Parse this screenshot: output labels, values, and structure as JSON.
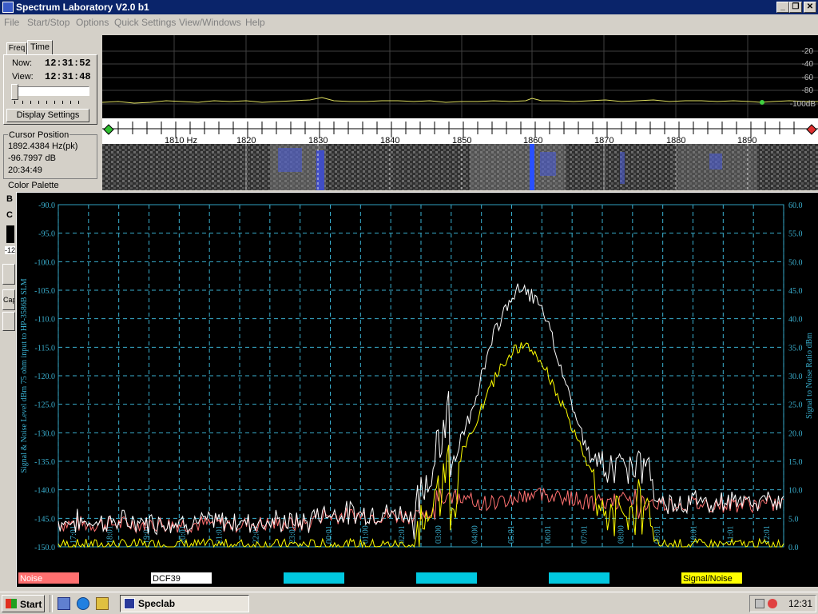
{
  "window": {
    "title": "Spectrum Laboratory V2.0 b1"
  },
  "menu": [
    "File",
    "Start/Stop",
    "Options",
    "Quick Settings",
    "View/Windows",
    "Help"
  ],
  "left_panel": {
    "tabs": [
      "Freq",
      "Time"
    ],
    "now_label": "Now:",
    "now_value": "12:31:52",
    "view_label": "View:",
    "view_value": "12:31:48",
    "display_settings": "Display Settings",
    "cursor_title": "Cursor Position",
    "cursor_freq": "1892.4384 Hz(pk)",
    "cursor_level": "-96.7997 dB",
    "cursor_time": "20:34:49",
    "color_palette": "Color Palette",
    "partial_b": "B",
    "partial_c": "C",
    "partial_cap": "Cap",
    "partial_num": "-12"
  },
  "spectrum": {
    "db_ticks": [
      "-20",
      "-40",
      "-60",
      "-80",
      "-100dB"
    ],
    "freq_ticks": [
      "1810 Hz",
      "1820",
      "1830",
      "1840",
      "1850",
      "1860",
      "1870",
      "1880",
      "1890"
    ]
  },
  "chart_data": {
    "type": "line",
    "ylabel": "Signal & Noise Level dBm 75 ohm input to HP-3586B SLM",
    "y2label": "Signal to Noise Ratio  dBm",
    "ylim": [
      -150,
      -90
    ],
    "y2lim": [
      0,
      60
    ],
    "y_ticks": [
      "-90.0",
      "-95.0",
      "-100.0",
      "-105.0",
      "-110.0",
      "-115.0",
      "-120.0",
      "-125.0",
      "-130.0",
      "-135.0",
      "-140.0",
      "-145.0",
      "-150.0"
    ],
    "y2_ticks": [
      "60.0",
      "55.0",
      "50.0",
      "45.0",
      "40.0",
      "35.0",
      "30.0",
      "25.0",
      "20.0",
      "15.0",
      "10.0",
      "5.0",
      "0.0"
    ],
    "x_ticks": [
      "17:01",
      "18:01",
      "19:01",
      "20:01",
      "21:01",
      "22:01",
      "23:01",
      "00:01",
      "01:00",
      "02:01",
      "03:00",
      "04:00",
      "05:01",
      "06:01",
      "07:01",
      "08:00",
      "09:01",
      "10:01",
      "11:01",
      "12:01"
    ],
    "series": [
      {
        "name": "Noise",
        "color": "#ff7070"
      },
      {
        "name": "DCF39",
        "color": "#ffffff"
      },
      {
        "name": "Signal/Noise",
        "color": "#ffff00"
      }
    ],
    "legend_empty_colors": [
      "#00c8e0",
      "#00c8e0",
      "#00c8e0"
    ]
  },
  "taskbar": {
    "start": "Start",
    "task": "Speclab",
    "clock": "12:31"
  }
}
